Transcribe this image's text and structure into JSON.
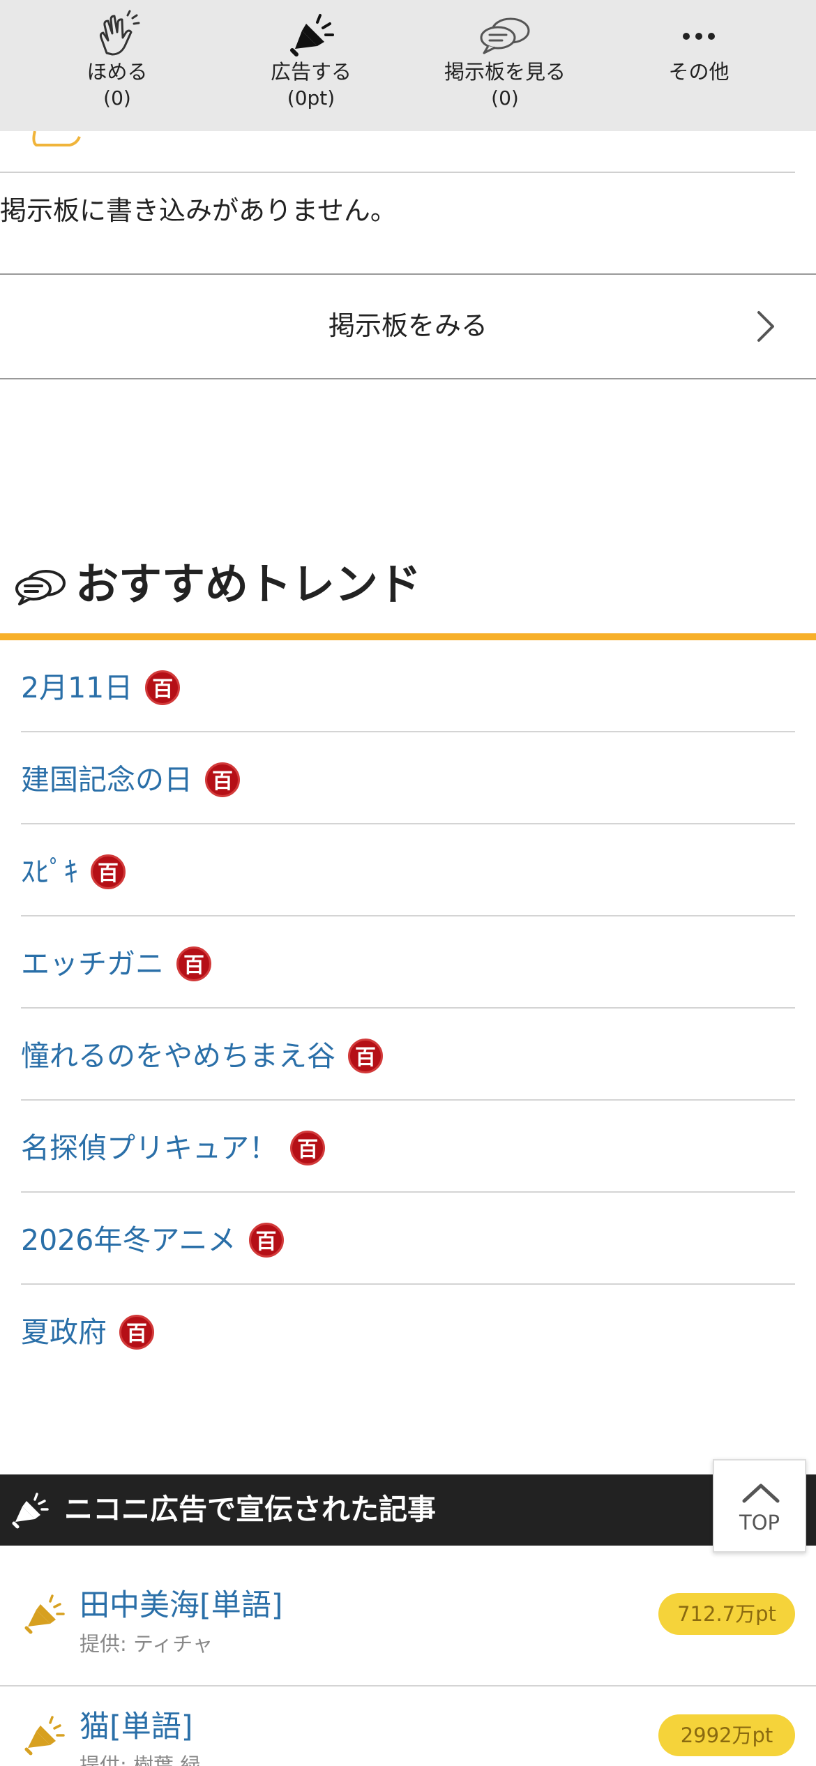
{
  "toolbar": {
    "items": [
      {
        "icon": "clap-hands-icon",
        "label": "ほめる",
        "count": "(0)"
      },
      {
        "icon": "megaphone-icon",
        "label": "広告する",
        "count": "(0pt)"
      },
      {
        "icon": "chat-bubbles-icon",
        "label": "掲示板を見る",
        "count": "(0)"
      },
      {
        "icon": "more-dots-icon",
        "label": "その他",
        "count": ""
      }
    ]
  },
  "board": {
    "empty_message": "掲示板に書き込みがありません。",
    "view_link": "掲示板をみる"
  },
  "trends": {
    "title": "おすすめトレンド",
    "badge": "百",
    "items": [
      "2月11日",
      "建国記念の日",
      "ｽﾋﾟｷ",
      "エッチガニ",
      "憧れるのをやめちまえ谷",
      "名探偵プリキュア！",
      "2026年冬アニメ",
      "夏政府"
    ]
  },
  "ads": {
    "title": "ニコニ広告で宣伝された記事",
    "top_button": "TOP",
    "items": [
      {
        "title": "田中美海[単語]",
        "sub": "提供: ティチャ",
        "points": "712.7万pt"
      },
      {
        "title": "猫[単語]",
        "sub": "提供: 樹葉 緑",
        "points": "2992万pt"
      }
    ]
  },
  "colors": {
    "link": "#2a6fa8",
    "trend_rule": "#f7b02a",
    "badge_red": "#b50f16",
    "ad_header": "#222222",
    "points_pill": "#f5d33a",
    "toolbar_bg": "#e8e8e8"
  }
}
